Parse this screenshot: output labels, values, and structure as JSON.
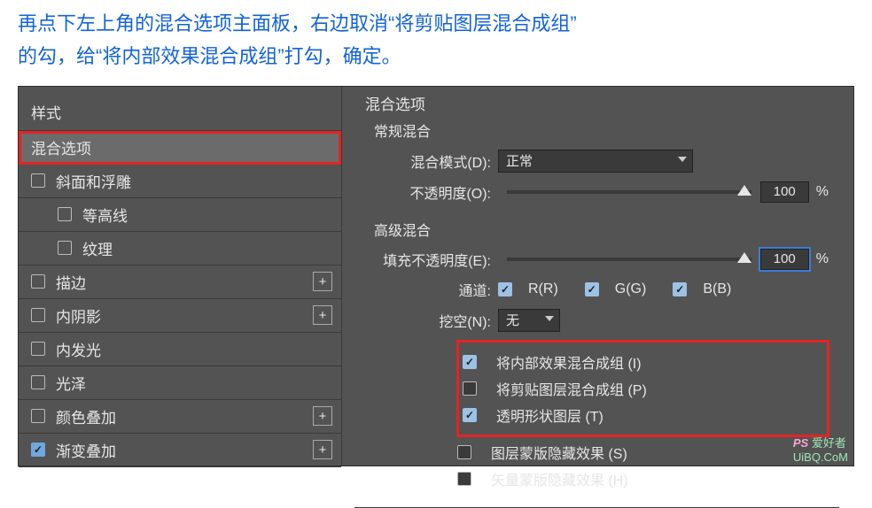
{
  "caption": {
    "line1": "再点下左上角的混合选项主面板，右边取消“将剪贴图层混合成组”",
    "line2": "的勾，给“将内部效果混合成组”打勾，确定。"
  },
  "left": {
    "header": "样式",
    "items": [
      {
        "label": "混合选项",
        "selected": true,
        "checkbox": false,
        "indent": 0,
        "plus": false,
        "red": true
      },
      {
        "label": "斜面和浮雕",
        "selected": false,
        "checkbox": true,
        "checked": false,
        "indent": 0,
        "plus": false
      },
      {
        "label": "等高线",
        "selected": false,
        "checkbox": true,
        "checked": false,
        "indent": 1,
        "plus": false
      },
      {
        "label": "纹理",
        "selected": false,
        "checkbox": true,
        "checked": false,
        "indent": 1,
        "plus": false
      },
      {
        "label": "描边",
        "selected": false,
        "checkbox": true,
        "checked": false,
        "indent": 0,
        "plus": true
      },
      {
        "label": "内阴影",
        "selected": false,
        "checkbox": true,
        "checked": false,
        "indent": 0,
        "plus": true
      },
      {
        "label": "内发光",
        "selected": false,
        "checkbox": true,
        "checked": false,
        "indent": 0,
        "plus": false
      },
      {
        "label": "光泽",
        "selected": false,
        "checkbox": true,
        "checked": false,
        "indent": 0,
        "plus": false
      },
      {
        "label": "颜色叠加",
        "selected": false,
        "checkbox": true,
        "checked": false,
        "indent": 0,
        "plus": true
      },
      {
        "label": "渐变叠加",
        "selected": false,
        "checkbox": true,
        "checked": true,
        "indent": 0,
        "plus": true
      }
    ]
  },
  "right": {
    "title": "混合选项",
    "group1": {
      "title": "常规混合",
      "blend_mode_label": "混合模式(D):",
      "blend_mode_value": "正常",
      "opacity_label": "不透明度(O):",
      "opacity_value": "100",
      "pct": "%"
    },
    "group2": {
      "title": "高级混合",
      "fill_label": "填充不透明度(E):",
      "fill_value": "100",
      "pct": "%",
      "channels_label": "通道:",
      "ch_r": "R(R)",
      "ch_g": "G(G)",
      "ch_b": "B(B)",
      "knockout_label": "挖空(N):",
      "knockout_value": "无",
      "opt1": "将内部效果混合成组 (I)",
      "opt2": "将剪贴图层混合成组 (P)",
      "opt3": "透明形状图层 (T)",
      "opt4": "图层蒙版隐藏效果 (S)",
      "opt5": "矢量蒙版隐藏效果 (H)"
    }
  },
  "watermark": {
    "ps": "PS",
    "txt": "爱好者",
    "url": "UiBQ.CoM"
  }
}
